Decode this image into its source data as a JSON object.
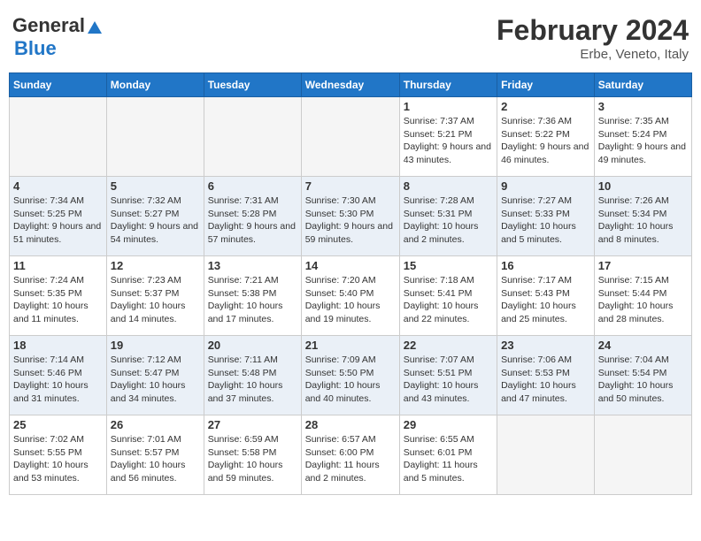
{
  "header": {
    "logo_general": "General",
    "logo_blue": "Blue",
    "month_year": "February 2024",
    "location": "Erbe, Veneto, Italy"
  },
  "days_of_week": [
    "Sunday",
    "Monday",
    "Tuesday",
    "Wednesday",
    "Thursday",
    "Friday",
    "Saturday"
  ],
  "weeks": [
    [
      {
        "num": "",
        "info": ""
      },
      {
        "num": "",
        "info": ""
      },
      {
        "num": "",
        "info": ""
      },
      {
        "num": "",
        "info": ""
      },
      {
        "num": "1",
        "info": "Sunrise: 7:37 AM\nSunset: 5:21 PM\nDaylight: 9 hours and 43 minutes."
      },
      {
        "num": "2",
        "info": "Sunrise: 7:36 AM\nSunset: 5:22 PM\nDaylight: 9 hours and 46 minutes."
      },
      {
        "num": "3",
        "info": "Sunrise: 7:35 AM\nSunset: 5:24 PM\nDaylight: 9 hours and 49 minutes."
      }
    ],
    [
      {
        "num": "4",
        "info": "Sunrise: 7:34 AM\nSunset: 5:25 PM\nDaylight: 9 hours and 51 minutes."
      },
      {
        "num": "5",
        "info": "Sunrise: 7:32 AM\nSunset: 5:27 PM\nDaylight: 9 hours and 54 minutes."
      },
      {
        "num": "6",
        "info": "Sunrise: 7:31 AM\nSunset: 5:28 PM\nDaylight: 9 hours and 57 minutes."
      },
      {
        "num": "7",
        "info": "Sunrise: 7:30 AM\nSunset: 5:30 PM\nDaylight: 9 hours and 59 minutes."
      },
      {
        "num": "8",
        "info": "Sunrise: 7:28 AM\nSunset: 5:31 PM\nDaylight: 10 hours and 2 minutes."
      },
      {
        "num": "9",
        "info": "Sunrise: 7:27 AM\nSunset: 5:33 PM\nDaylight: 10 hours and 5 minutes."
      },
      {
        "num": "10",
        "info": "Sunrise: 7:26 AM\nSunset: 5:34 PM\nDaylight: 10 hours and 8 minutes."
      }
    ],
    [
      {
        "num": "11",
        "info": "Sunrise: 7:24 AM\nSunset: 5:35 PM\nDaylight: 10 hours and 11 minutes."
      },
      {
        "num": "12",
        "info": "Sunrise: 7:23 AM\nSunset: 5:37 PM\nDaylight: 10 hours and 14 minutes."
      },
      {
        "num": "13",
        "info": "Sunrise: 7:21 AM\nSunset: 5:38 PM\nDaylight: 10 hours and 17 minutes."
      },
      {
        "num": "14",
        "info": "Sunrise: 7:20 AM\nSunset: 5:40 PM\nDaylight: 10 hours and 19 minutes."
      },
      {
        "num": "15",
        "info": "Sunrise: 7:18 AM\nSunset: 5:41 PM\nDaylight: 10 hours and 22 minutes."
      },
      {
        "num": "16",
        "info": "Sunrise: 7:17 AM\nSunset: 5:43 PM\nDaylight: 10 hours and 25 minutes."
      },
      {
        "num": "17",
        "info": "Sunrise: 7:15 AM\nSunset: 5:44 PM\nDaylight: 10 hours and 28 minutes."
      }
    ],
    [
      {
        "num": "18",
        "info": "Sunrise: 7:14 AM\nSunset: 5:46 PM\nDaylight: 10 hours and 31 minutes."
      },
      {
        "num": "19",
        "info": "Sunrise: 7:12 AM\nSunset: 5:47 PM\nDaylight: 10 hours and 34 minutes."
      },
      {
        "num": "20",
        "info": "Sunrise: 7:11 AM\nSunset: 5:48 PM\nDaylight: 10 hours and 37 minutes."
      },
      {
        "num": "21",
        "info": "Sunrise: 7:09 AM\nSunset: 5:50 PM\nDaylight: 10 hours and 40 minutes."
      },
      {
        "num": "22",
        "info": "Sunrise: 7:07 AM\nSunset: 5:51 PM\nDaylight: 10 hours and 43 minutes."
      },
      {
        "num": "23",
        "info": "Sunrise: 7:06 AM\nSunset: 5:53 PM\nDaylight: 10 hours and 47 minutes."
      },
      {
        "num": "24",
        "info": "Sunrise: 7:04 AM\nSunset: 5:54 PM\nDaylight: 10 hours and 50 minutes."
      }
    ],
    [
      {
        "num": "25",
        "info": "Sunrise: 7:02 AM\nSunset: 5:55 PM\nDaylight: 10 hours and 53 minutes."
      },
      {
        "num": "26",
        "info": "Sunrise: 7:01 AM\nSunset: 5:57 PM\nDaylight: 10 hours and 56 minutes."
      },
      {
        "num": "27",
        "info": "Sunrise: 6:59 AM\nSunset: 5:58 PM\nDaylight: 10 hours and 59 minutes."
      },
      {
        "num": "28",
        "info": "Sunrise: 6:57 AM\nSunset: 6:00 PM\nDaylight: 11 hours and 2 minutes."
      },
      {
        "num": "29",
        "info": "Sunrise: 6:55 AM\nSunset: 6:01 PM\nDaylight: 11 hours and 5 minutes."
      },
      {
        "num": "",
        "info": ""
      },
      {
        "num": "",
        "info": ""
      }
    ]
  ]
}
